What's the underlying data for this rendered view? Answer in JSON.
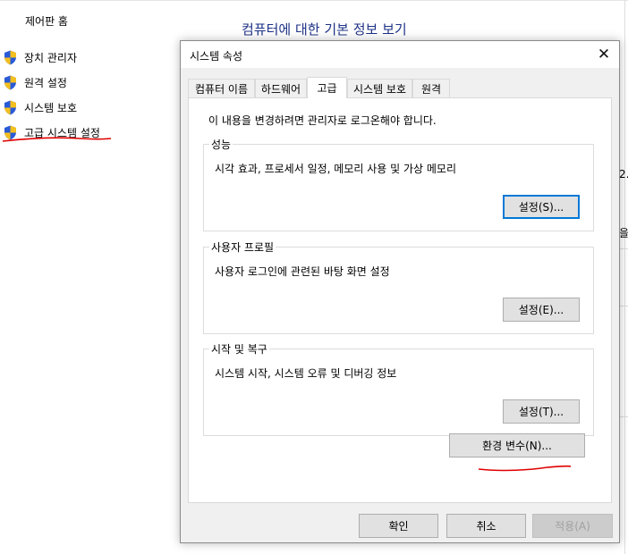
{
  "background": {
    "home": "제어판 홈",
    "heading": "컴퓨터에 대한 기본 정보 보기",
    "links": [
      {
        "label": "장치 관리자"
      },
      {
        "label": "원격 설정"
      },
      {
        "label": "시스템 보호"
      },
      {
        "label": "고급 시스템 설정"
      }
    ],
    "right_fragments": [
      "2.",
      "을"
    ]
  },
  "dialog": {
    "title": "시스템 속성",
    "close_glyph": "✕",
    "tabs": [
      {
        "label": "컴퓨터 이름"
      },
      {
        "label": "하드웨어"
      },
      {
        "label": "고급",
        "active": true
      },
      {
        "label": "시스템 보호"
      },
      {
        "label": "원격"
      }
    ],
    "notice": "이 내용을 변경하려면 관리자로 로그온해야 합니다.",
    "groups": [
      {
        "title": "성능",
        "description": "시각 효과, 프로세서 일정, 메모리 사용 및 가상 메모리",
        "button": "설정(S)..."
      },
      {
        "title": "사용자 프로필",
        "description": "사용자 로그인에 관련된 바탕 화면 설정",
        "button": "설정(E)..."
      },
      {
        "title": "시작 및 복구",
        "description": "시스템 시작, 시스템 오류 및 디버깅 정보",
        "button": "설정(T)..."
      }
    ],
    "env_button": "환경 변수(N)...",
    "footer": {
      "ok": "확인",
      "cancel": "취소",
      "apply": "적용(A)"
    }
  },
  "colors": {
    "heading": "#1e3287",
    "annotation": "#e00000",
    "focus": "#0078d7"
  },
  "icons": {
    "link_icon": "uac-shield-icon",
    "close": "close-icon"
  }
}
